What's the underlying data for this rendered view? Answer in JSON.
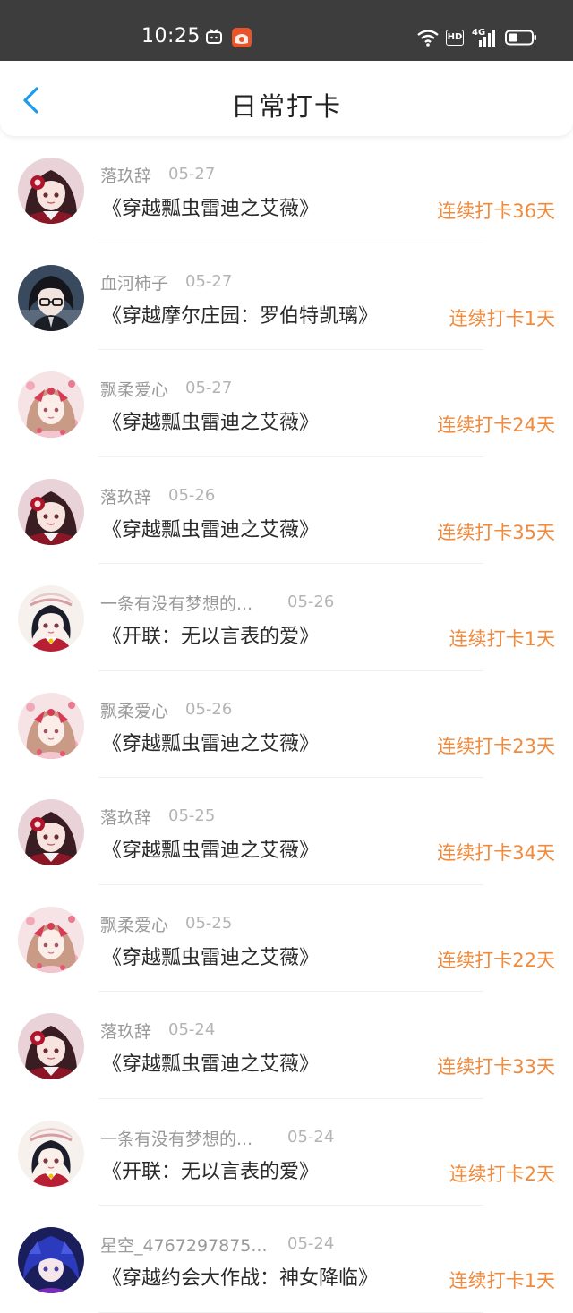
{
  "status_bar": {
    "time": "10:25",
    "hd": "HD",
    "network": "4G",
    "icons": [
      "tv-icon",
      "app-icon",
      "wifi-icon",
      "signal-icon",
      "battery-icon"
    ]
  },
  "header": {
    "title": "日常打卡",
    "back_icon": "chevron-left-icon"
  },
  "colors": {
    "accent_blue": "#1a9bf0",
    "streak_orange": "#f08a3c",
    "status_bar_bg": "#3d3d3d"
  },
  "entries": [
    {
      "user": "落玖辞",
      "date": "05-27",
      "book": "《穿越瓢虫雷迪之艾薇》",
      "streak": "连续打卡36天",
      "avatar": "a"
    },
    {
      "user": "血河柿子",
      "date": "05-27",
      "book": "《穿越摩尔庄园：罗伯特凯璃》",
      "streak": "连续打卡1天",
      "avatar": "b"
    },
    {
      "user": "飘柔爱心",
      "date": "05-27",
      "book": "《穿越瓢虫雷迪之艾薇》",
      "streak": "连续打卡24天",
      "avatar": "c"
    },
    {
      "user": "落玖辞",
      "date": "05-26",
      "book": "《穿越瓢虫雷迪之艾薇》",
      "streak": "连续打卡35天",
      "avatar": "a"
    },
    {
      "user": "一条有没有梦想的...",
      "date": "05-26",
      "book": "《开联：无以言表的爱》",
      "streak": "连续打卡1天",
      "avatar": "d"
    },
    {
      "user": "飘柔爱心",
      "date": "05-26",
      "book": "《穿越瓢虫雷迪之艾薇》",
      "streak": "连续打卡23天",
      "avatar": "c"
    },
    {
      "user": "落玖辞",
      "date": "05-25",
      "book": "《穿越瓢虫雷迪之艾薇》",
      "streak": "连续打卡34天",
      "avatar": "a"
    },
    {
      "user": "飘柔爱心",
      "date": "05-25",
      "book": "《穿越瓢虫雷迪之艾薇》",
      "streak": "连续打卡22天",
      "avatar": "c"
    },
    {
      "user": "落玖辞",
      "date": "05-24",
      "book": "《穿越瓢虫雷迪之艾薇》",
      "streak": "连续打卡33天",
      "avatar": "a"
    },
    {
      "user": "一条有没有梦想的...",
      "date": "05-24",
      "book": "《开联：无以言表的爱》",
      "streak": "连续打卡2天",
      "avatar": "d"
    },
    {
      "user": "星空_4767297875...",
      "date": "05-24",
      "book": "《穿越约会大作战：神女降临》",
      "streak": "连续打卡1天",
      "avatar": "e"
    }
  ]
}
